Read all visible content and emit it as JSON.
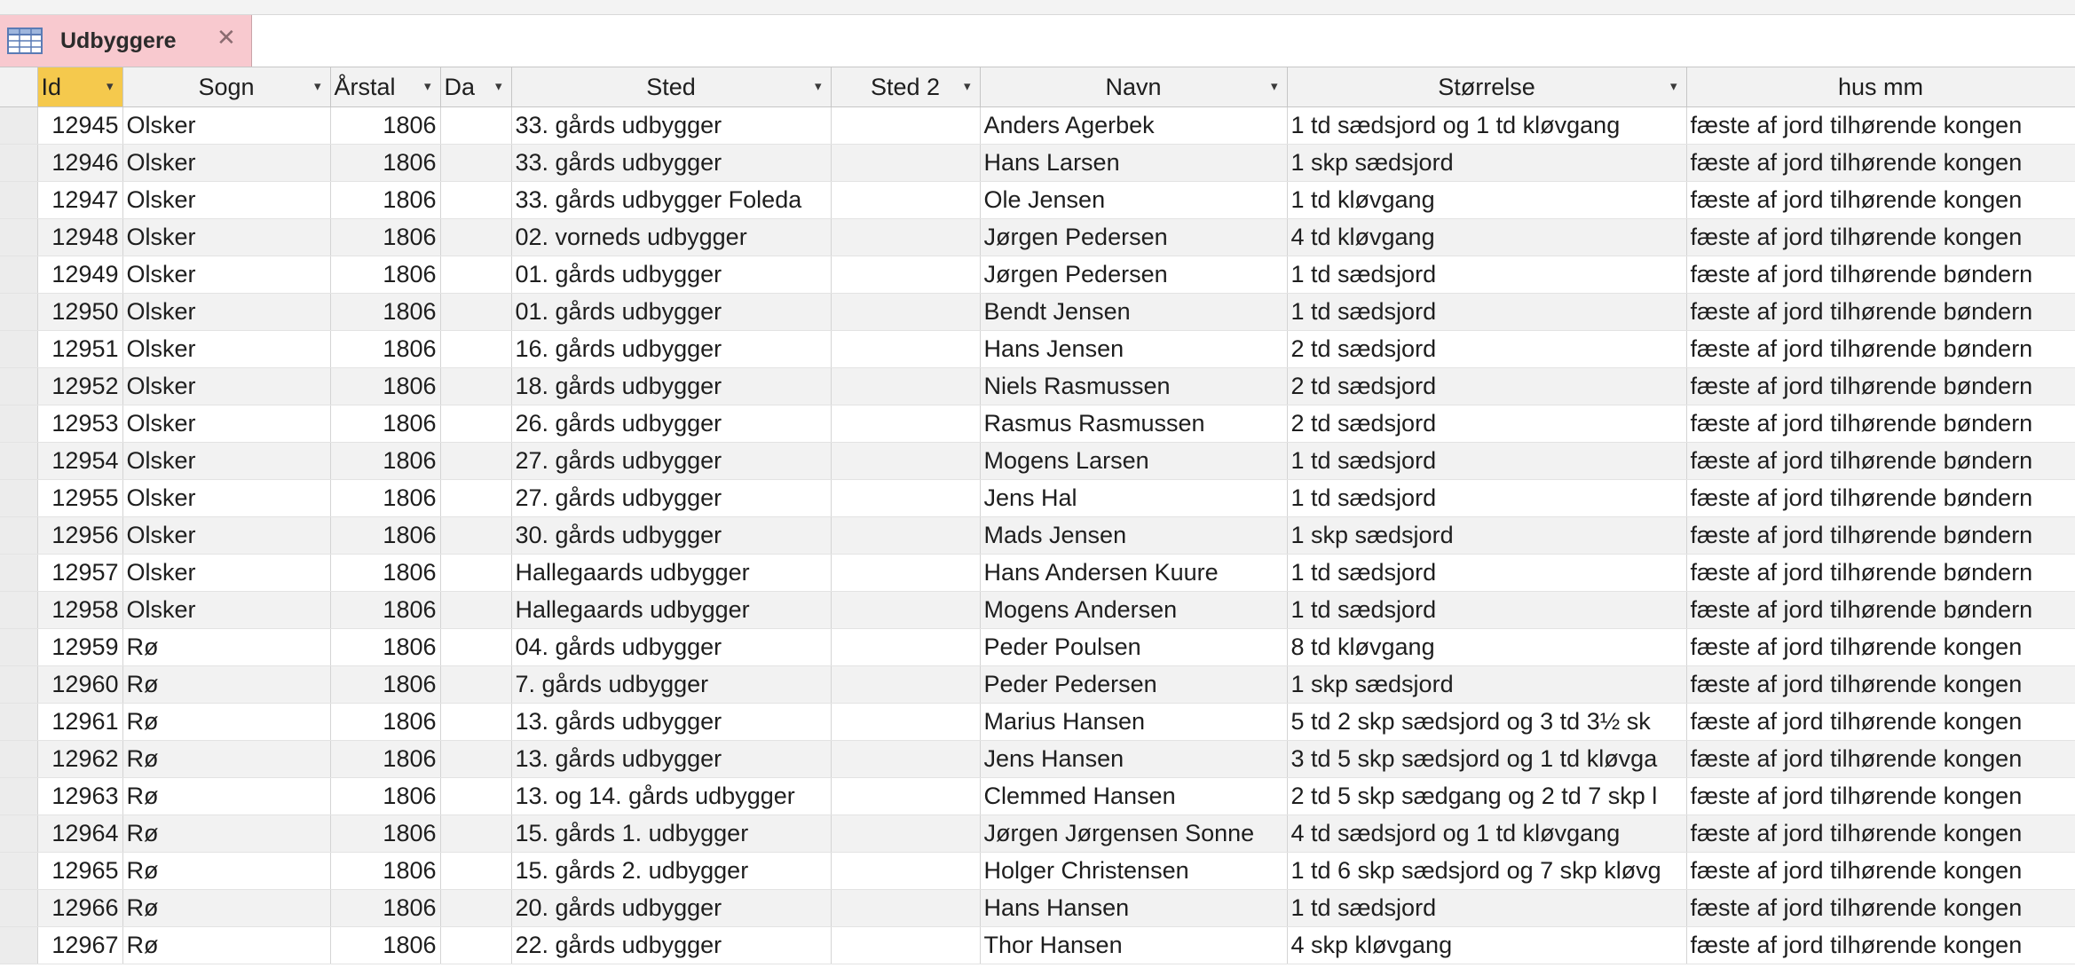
{
  "tab": {
    "label": "Udbyggere",
    "close_glyph": "✕",
    "icon": "table-icon"
  },
  "columns": [
    {
      "key": "id",
      "label": "Id",
      "has_arrow": true,
      "selected": true
    },
    {
      "key": "sogn",
      "label": "Sogn",
      "has_arrow": true
    },
    {
      "key": "aarstal",
      "label": "Årstal",
      "has_arrow": true
    },
    {
      "key": "da",
      "label": "Da",
      "has_arrow": true
    },
    {
      "key": "sted",
      "label": "Sted",
      "has_arrow": true
    },
    {
      "key": "sted2",
      "label": "Sted 2",
      "has_arrow": true
    },
    {
      "key": "navn",
      "label": "Navn",
      "has_arrow": true
    },
    {
      "key": "stoerrelse",
      "label": "Størrelse",
      "has_arrow": true
    },
    {
      "key": "husmm",
      "label": "hus mm",
      "has_arrow": false
    }
  ],
  "sort_arrow_glyph": "▾",
  "rows": [
    {
      "id": "12945",
      "sogn": "Olsker",
      "aarstal": "1806",
      "da": "",
      "sted": "33. gårds udbygger",
      "sted2": "",
      "navn": "Anders Agerbek",
      "stoerrelse": "1 td sædsjord og 1 td kløvgang",
      "husmm": "fæste af jord tilhørende kongen"
    },
    {
      "id": "12946",
      "sogn": "Olsker",
      "aarstal": "1806",
      "da": "",
      "sted": "33. gårds udbygger",
      "sted2": "",
      "navn": "Hans Larsen",
      "stoerrelse": "1 skp sædsjord",
      "husmm": "fæste af jord tilhørende kongen"
    },
    {
      "id": "12947",
      "sogn": "Olsker",
      "aarstal": "1806",
      "da": "",
      "sted": "33. gårds udbygger Foleda",
      "sted2": "",
      "navn": "Ole Jensen",
      "stoerrelse": "1 td kløvgang",
      "husmm": "fæste af jord tilhørende kongen"
    },
    {
      "id": "12948",
      "sogn": "Olsker",
      "aarstal": "1806",
      "da": "",
      "sted": "02. vorneds udbygger",
      "sted2": "",
      "navn": "Jørgen Pedersen",
      "stoerrelse": "4 td kløvgang",
      "husmm": "fæste af jord tilhørende kongen"
    },
    {
      "id": "12949",
      "sogn": "Olsker",
      "aarstal": "1806",
      "da": "",
      "sted": "01. gårds udbygger",
      "sted2": "",
      "navn": "Jørgen Pedersen",
      "stoerrelse": "1 td sædsjord",
      "husmm": "fæste af jord tilhørende bøndern"
    },
    {
      "id": "12950",
      "sogn": "Olsker",
      "aarstal": "1806",
      "da": "",
      "sted": "01. gårds udbygger",
      "sted2": "",
      "navn": "Bendt Jensen",
      "stoerrelse": "1 td sædsjord",
      "husmm": "fæste af jord tilhørende bøndern"
    },
    {
      "id": "12951",
      "sogn": "Olsker",
      "aarstal": "1806",
      "da": "",
      "sted": "16. gårds udbygger",
      "sted2": "",
      "navn": "Hans Jensen",
      "stoerrelse": "2 td sædsjord",
      "husmm": "fæste af jord tilhørende bøndern"
    },
    {
      "id": "12952",
      "sogn": "Olsker",
      "aarstal": "1806",
      "da": "",
      "sted": "18. gårds udbygger",
      "sted2": "",
      "navn": "Niels Rasmussen",
      "stoerrelse": "2 td sædsjord",
      "husmm": "fæste af jord tilhørende bøndern"
    },
    {
      "id": "12953",
      "sogn": "Olsker",
      "aarstal": "1806",
      "da": "",
      "sted": "26. gårds udbygger",
      "sted2": "",
      "navn": "Rasmus Rasmussen",
      "stoerrelse": "2 td sædsjord",
      "husmm": "fæste af jord tilhørende bøndern"
    },
    {
      "id": "12954",
      "sogn": "Olsker",
      "aarstal": "1806",
      "da": "",
      "sted": "27. gårds udbygger",
      "sted2": "",
      "navn": "Mogens Larsen",
      "stoerrelse": "1 td sædsjord",
      "husmm": "fæste af jord tilhørende bøndern"
    },
    {
      "id": "12955",
      "sogn": "Olsker",
      "aarstal": "1806",
      "da": "",
      "sted": "27. gårds udbygger",
      "sted2": "",
      "navn": "Jens Hal",
      "stoerrelse": "1 td sædsjord",
      "husmm": "fæste af jord tilhørende bøndern"
    },
    {
      "id": "12956",
      "sogn": "Olsker",
      "aarstal": "1806",
      "da": "",
      "sted": "30. gårds udbygger",
      "sted2": "",
      "navn": "Mads Jensen",
      "stoerrelse": "1 skp sædsjord",
      "husmm": "fæste af jord tilhørende bøndern"
    },
    {
      "id": "12957",
      "sogn": "Olsker",
      "aarstal": "1806",
      "da": "",
      "sted": "Hallegaards udbygger",
      "sted2": "",
      "navn": "Hans Andersen Kuure",
      "stoerrelse": "1 td sædsjord",
      "husmm": "fæste af jord tilhørende bøndern"
    },
    {
      "id": "12958",
      "sogn": "Olsker",
      "aarstal": "1806",
      "da": "",
      "sted": "Hallegaards udbygger",
      "sted2": "",
      "navn": "Mogens Andersen",
      "stoerrelse": "1 td sædsjord",
      "husmm": "fæste af jord tilhørende bøndern"
    },
    {
      "id": "12959",
      "sogn": "Rø",
      "aarstal": "1806",
      "da": "",
      "sted": "04. gårds udbygger",
      "sted2": "",
      "navn": "Peder Poulsen",
      "stoerrelse": "8 td kløvgang",
      "husmm": "fæste af jord tilhørende kongen"
    },
    {
      "id": "12960",
      "sogn": "Rø",
      "aarstal": "1806",
      "da": "",
      "sted": "7. gårds udbygger",
      "sted2": "",
      "navn": "Peder Pedersen",
      "stoerrelse": "1 skp sædsjord",
      "husmm": "fæste af jord tilhørende kongen"
    },
    {
      "id": "12961",
      "sogn": "Rø",
      "aarstal": "1806",
      "da": "",
      "sted": "13. gårds udbygger",
      "sted2": "",
      "navn": "Marius Hansen",
      "stoerrelse": "5 td 2 skp sædsjord og 3 td  3½ sk",
      "husmm": "fæste af jord tilhørende kongen"
    },
    {
      "id": "12962",
      "sogn": "Rø",
      "aarstal": "1806",
      "da": "",
      "sted": "13. gårds udbygger",
      "sted2": "",
      "navn": "Jens Hansen",
      "stoerrelse": "3 td 5 skp sædsjord og 1 td kløvga",
      "husmm": "fæste af jord tilhørende kongen"
    },
    {
      "id": "12963",
      "sogn": "Rø",
      "aarstal": "1806",
      "da": "",
      "sted": "13. og 14. gårds udbygger",
      "sted2": "",
      "navn": "Clemmed Hansen",
      "stoerrelse": "2 td 5 skp sædgang og 2 td 7 skp l",
      "husmm": "fæste af jord tilhørende kongen"
    },
    {
      "id": "12964",
      "sogn": "Rø",
      "aarstal": "1806",
      "da": "",
      "sted": "15. gårds 1. udbygger",
      "sted2": "",
      "navn": "Jørgen Jørgensen Sonne",
      "stoerrelse": "4 td sædsjord og 1 td kløvgang",
      "husmm": "fæste af jord tilhørende kongen"
    },
    {
      "id": "12965",
      "sogn": "Rø",
      "aarstal": "1806",
      "da": "",
      "sted": "15. gårds 2. udbygger",
      "sted2": "",
      "navn": "Holger Christensen",
      "stoerrelse": "1 td 6 skp sædsjord og 7 skp kløvg",
      "husmm": "fæste af jord tilhørende kongen"
    },
    {
      "id": "12966",
      "sogn": "Rø",
      "aarstal": "1806",
      "da": "",
      "sted": "20. gårds udbygger",
      "sted2": "",
      "navn": "Hans Hansen",
      "stoerrelse": "1 td sædsjord",
      "husmm": "fæste af jord tilhørende kongen"
    },
    {
      "id": "12967",
      "sogn": "Rø",
      "aarstal": "1806",
      "da": "",
      "sted": "22. gårds udbygger",
      "sted2": "",
      "navn": "Thor Hansen",
      "stoerrelse": "4 skp kløvgang",
      "husmm": "fæste af jord tilhørende kongen"
    }
  ]
}
